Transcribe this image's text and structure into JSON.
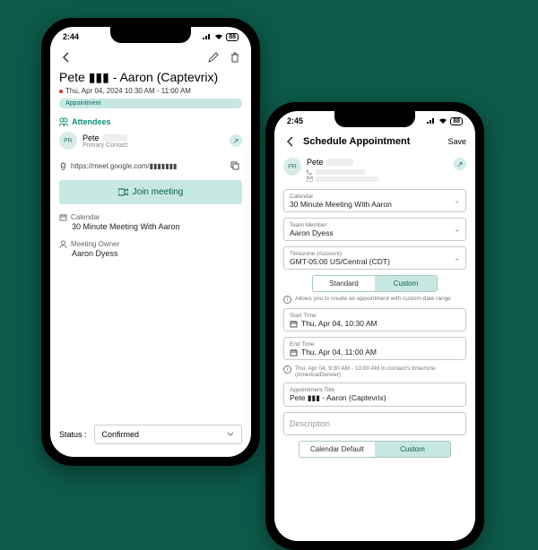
{
  "phone1": {
    "status": {
      "time": "2:44",
      "battery": "88"
    },
    "title": "Pete ▮▮▮ - Aaron (Captevrix)",
    "datetime": "Thu, Apr 04, 2024 10:30 AM - 11:00 AM",
    "badge": "Appointment",
    "attendees_label": "Attendees",
    "attendee": {
      "initials": "PR",
      "name": "Pete",
      "role": "Primary Contact"
    },
    "meet_url": "https://meet.google.com/▮▮▮▮▮▮▮",
    "join_label": "Join meeting",
    "calendar_label": "Calendar",
    "calendar_value": "30 Minute Meeting With Aaron",
    "owner_label": "Meeting Owner",
    "owner_value": "Aaron Dyess",
    "status_label": "Status :",
    "status_value": "Confirmed"
  },
  "phone2": {
    "status": {
      "time": "2:45",
      "battery": "88"
    },
    "title": "Schedule Appointment",
    "save": "Save",
    "contact": {
      "initials": "PR",
      "name": "Pete"
    },
    "fields": {
      "calendar": {
        "label": "Calendar",
        "value": "30 Minute Meeting With Aaron"
      },
      "team": {
        "label": "Team Member",
        "value": "Aaron Dyess"
      },
      "timezone": {
        "label": "Timezone (Account)",
        "value": "GMT-05:00 US/Central (CDT)"
      },
      "start": {
        "label": "Start Time",
        "value": "Thu, Apr 04, 10:30 AM"
      },
      "end": {
        "label": "End Time",
        "value": "Thu, Apr 04, 11:00 AM"
      },
      "appt_title": {
        "label": "Appointment Title",
        "value": "Pete ▮▮▮ - Aaron (Captevrix)"
      }
    },
    "toggle1": {
      "left": "Standard",
      "right": "Custom"
    },
    "hint1": "Allows you to create an appointment with custom date range",
    "hint2": "Thu, Apr 04, 9:30 AM - 10:00 AM in contact's timezone (America/Denver)",
    "description_placeholder": "Description",
    "toggle2": {
      "left": "Calendar Default",
      "right": "Custom"
    }
  }
}
